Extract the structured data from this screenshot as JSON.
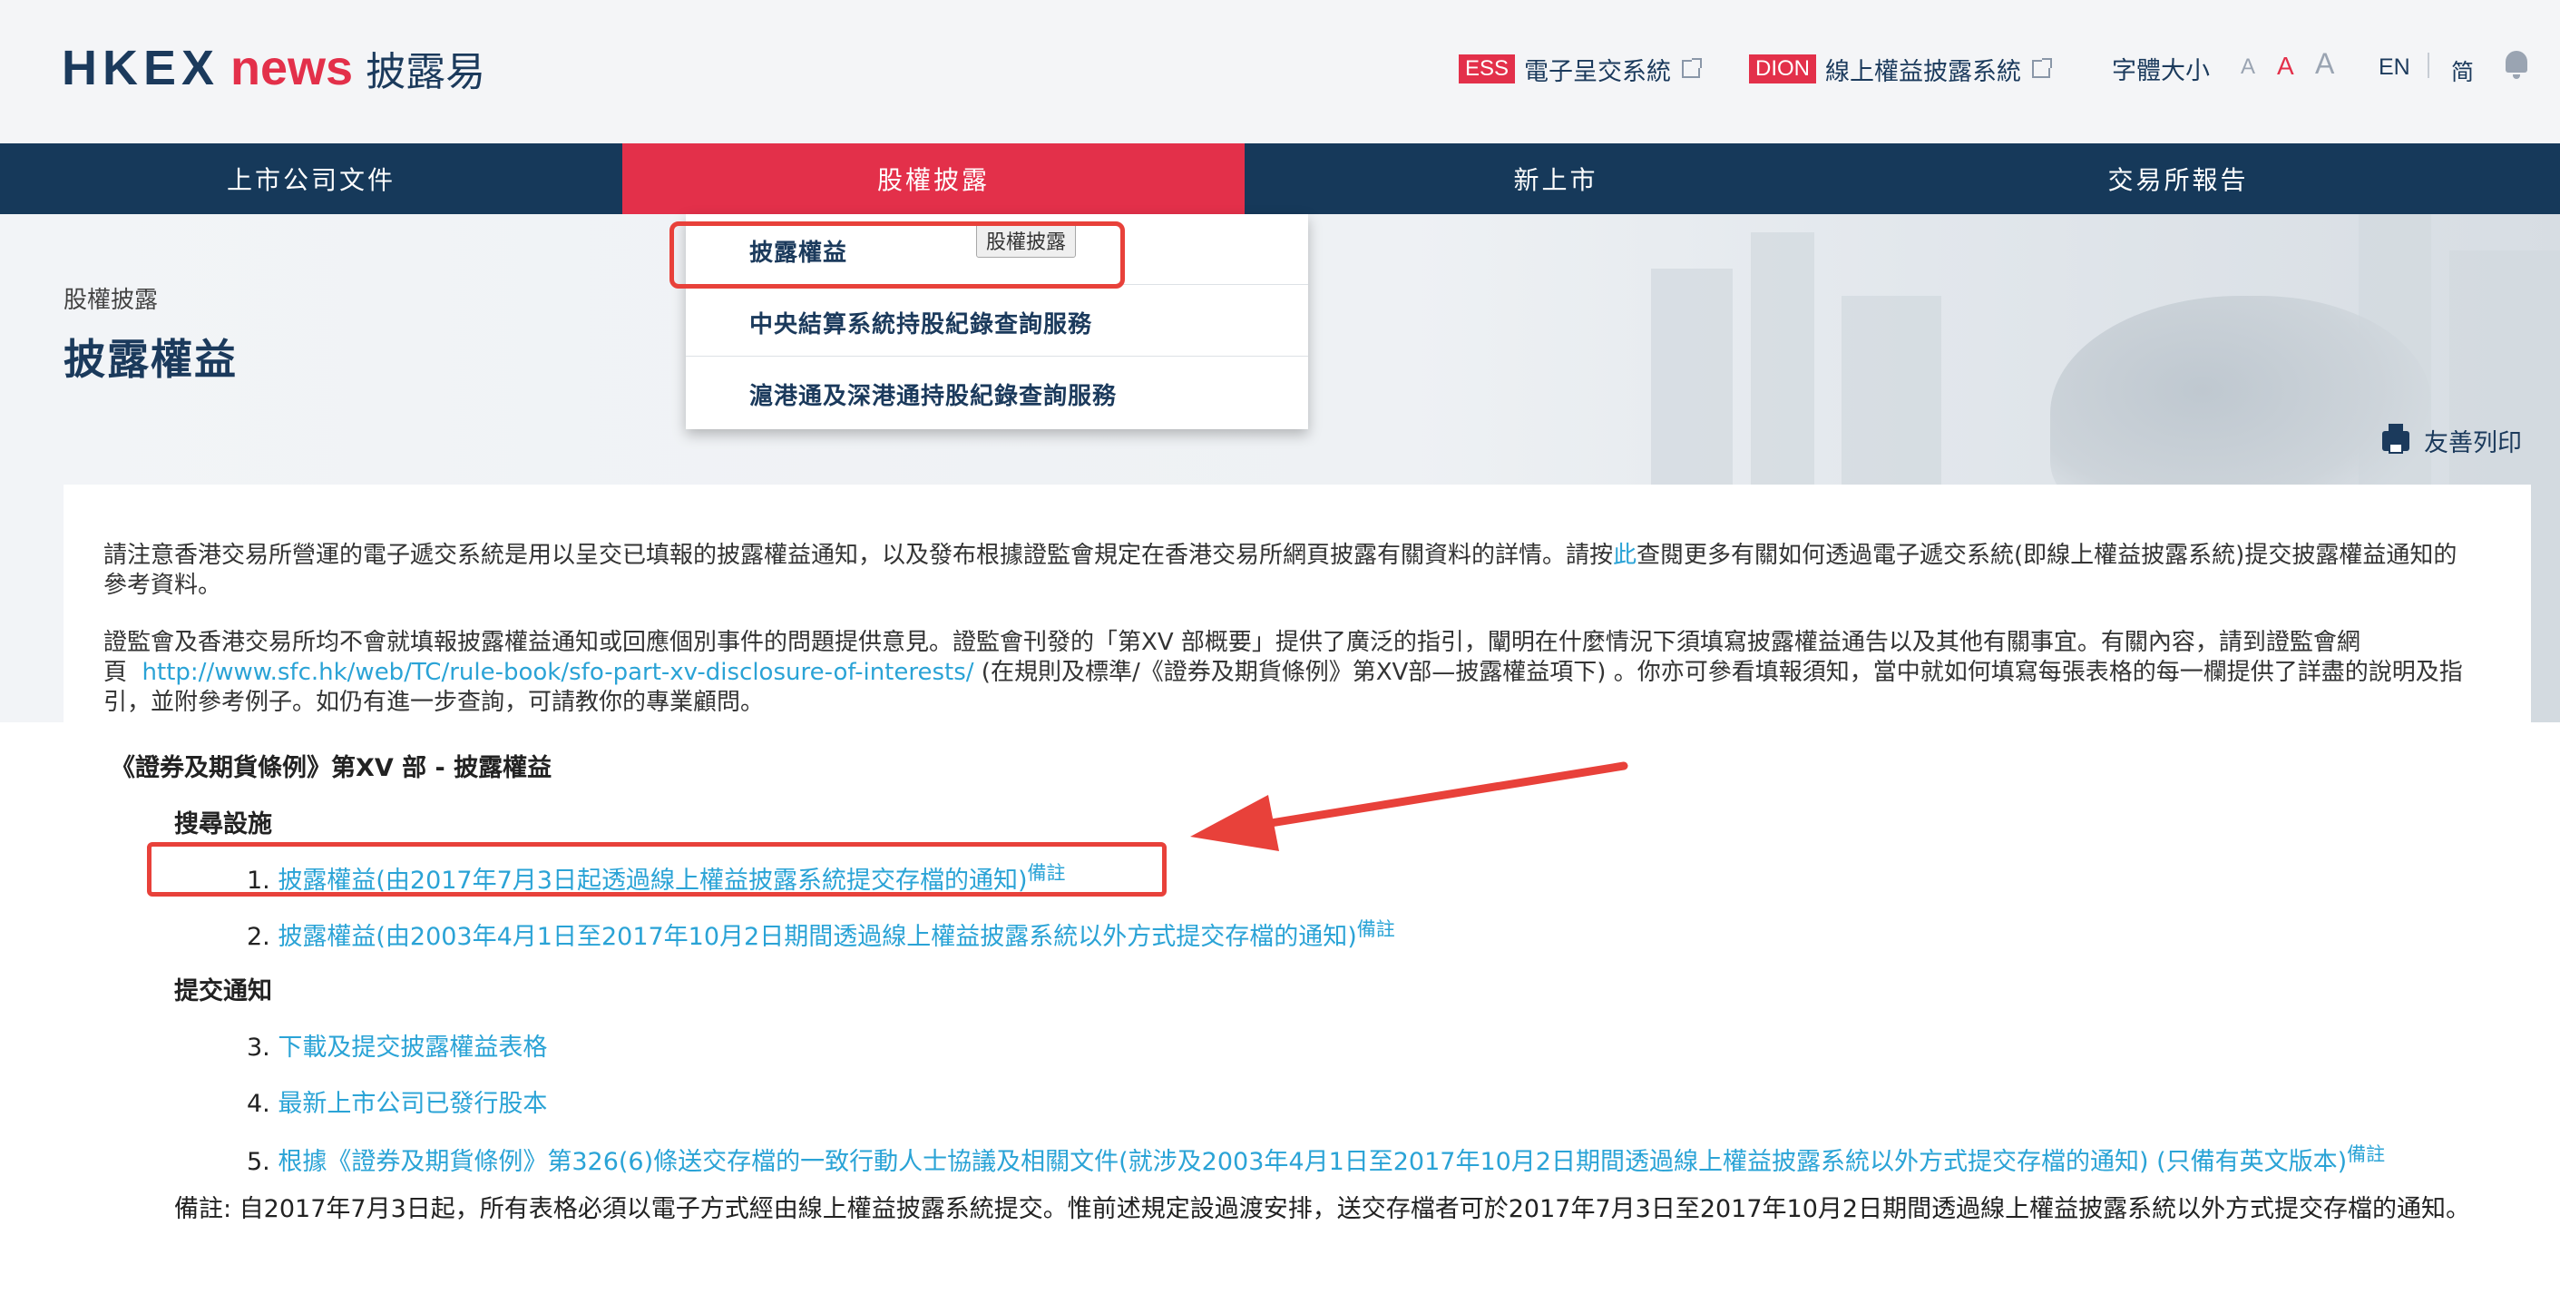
{
  "header": {
    "logo_hkex": "HKEX",
    "logo_news": "news",
    "logo_cn": "披露易",
    "ess_tag": "ESS",
    "ess_label": "電子呈交系統",
    "dion_tag": "DION",
    "dion_label": "線上權益披露系統",
    "fontsize_label": "字體大小",
    "font_small": "A",
    "font_medium": "A",
    "font_large": "A",
    "lang_en": "EN",
    "lang_sc": "简"
  },
  "nav": {
    "items": [
      "上市公司文件",
      "股權披露",
      "新上市",
      "交易所報告"
    ],
    "active_index": 1
  },
  "dropdown": {
    "items": [
      "披露權益",
      "中央結算系統持股紀錄查詢服務",
      "滬港通及深港通持股紀錄查詢服務"
    ],
    "tooltip": "股權披露"
  },
  "page": {
    "breadcrumb": "股權披露",
    "title": "披露權益",
    "print_label": "友善列印"
  },
  "content": {
    "para1_a": "請注意香港交易所營運的電子遞交系統是用以呈交已填報的披露權益通知，以及發布根據證監會規定在香港交易所網頁披露有關資料的詳情。請按",
    "para1_link": "此",
    "para1_b": "查閱更多有關如何透過電子遞交系統(即線上權益披露系統)提交披露權益通知的參考資料。",
    "para2_a": "證監會及香港交易所均不會就填報披露權益通知或回應個別事件的問題提供意見。證監會刊發的「第XV 部概要」提供了廣泛的指引，闡明在什麼情況下須填寫披露權益通告以及其他有關事宜。有關內容，請到證監會網頁",
    "para2_link": "http://www.sfc.hk/web/TC/rule-book/sfo-part-xv-disclosure-of-interests/",
    "para2_b": "(在規則及標準/《證券及期貨條例》第XV部—披露權益項下) 。你亦可參看填報須知，當中就如何填寫每張表格的每一欄提供了詳盡的說明及指引，並附參考例子。如仍有進一步查詢，可請教你的專業顧問。",
    "section_title": "《證券及期貨條例》第XV 部 - 披露權益",
    "search_heading": "搜尋設施",
    "submit_heading": "提交通知",
    "items": [
      {
        "num": "1.",
        "text": "披露權益(由2017年7月3日起透過線上權益披露系統提交存檔的通知)",
        "note": "備註"
      },
      {
        "num": "2.",
        "text": "披露權益(由2003年4月1日至2017年10月2日期間透過線上權益披露系統以外方式提交存檔的通知)",
        "note": "備註"
      },
      {
        "num": "3.",
        "text": "下載及提交披露權益表格",
        "note": ""
      },
      {
        "num": "4.",
        "text": "最新上市公司已發行股本",
        "note": ""
      },
      {
        "num": "5.",
        "text": "根據《證券及期貨條例》第326(6)條送交存檔的一致行動人士協議及相關文件(就涉及2003年4月1日至2017年10月2日期間透過線上權益披露系統以外方式提交存檔的通知) (只備有英文版本)",
        "note": "備註"
      }
    ],
    "footnote": "備註: 自2017年7月3日起，所有表格必須以電子方式經由線上權益披露系統提交。惟前述規定設過渡安排，送交存檔者可於2017年7月3日至2017年10月2日期間透過線上權益披露系統以外方式提交存檔的通知。"
  },
  "colors": {
    "brand_navy": "#16395a",
    "brand_red": "#e3304a",
    "link_blue": "#2aa3d6",
    "annotation_red": "#e8413a"
  }
}
